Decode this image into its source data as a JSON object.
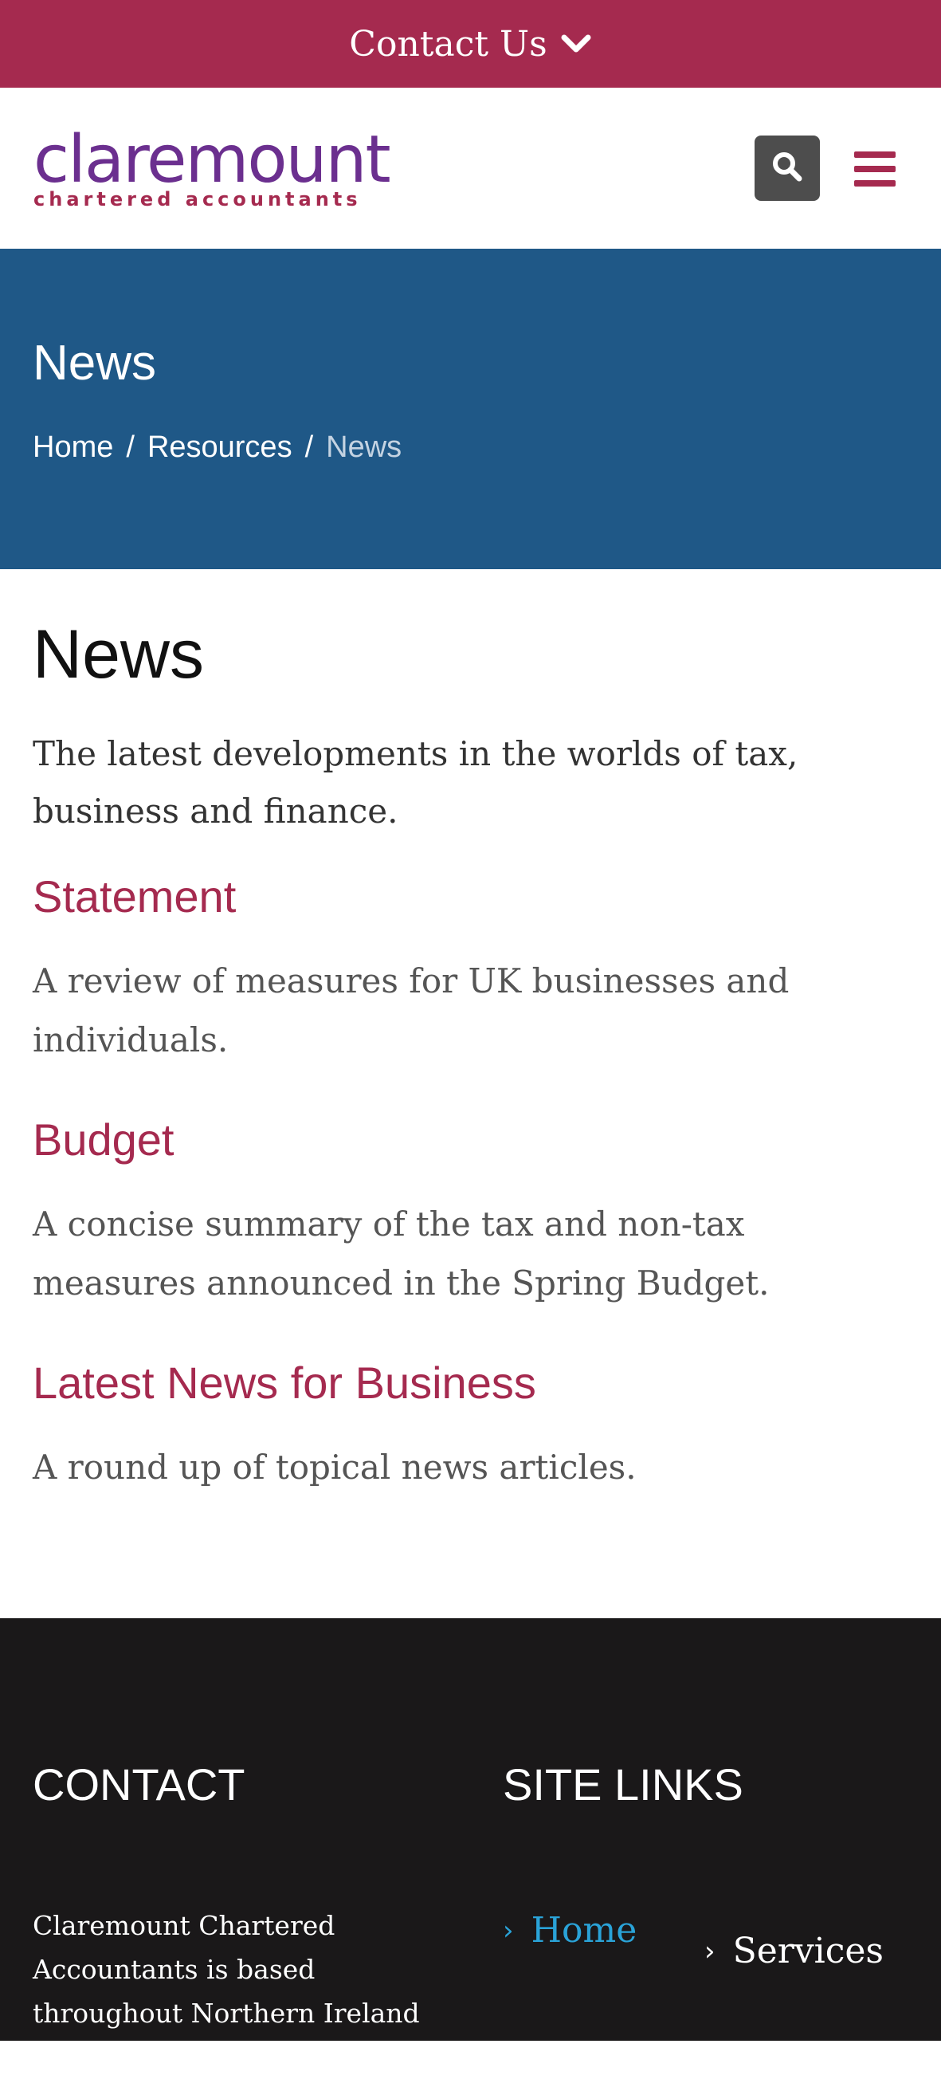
{
  "topbar": {
    "label": "Contact Us",
    "icon": "chevron-down-icon"
  },
  "header": {
    "logo_main": "claremount",
    "logo_sub": "chartered accountants",
    "search_icon": "search-icon",
    "menu_icon": "hamburger-icon"
  },
  "hero": {
    "title": "News",
    "breadcrumb": [
      "Home",
      "Resources",
      "News"
    ],
    "separator": "/"
  },
  "main": {
    "title": "News",
    "intro": "The latest developments in the worlds of tax, business and finance.",
    "sections": [
      {
        "title": "Statement",
        "text": "A review of measures for UK businesses and individuals."
      },
      {
        "title": "Budget",
        "text": "A concise summary of the tax and non-tax measures announced in the Spring Budget."
      },
      {
        "title": "Latest News for Business",
        "text": "A round up of topical news articles."
      }
    ]
  },
  "footer": {
    "contact_heading": "CONTACT",
    "links_heading": "SITE LINKS",
    "contact_text": "Claremount Chartered Accountants is based throughout Northern Ireland in",
    "links": [
      "Home",
      "Services"
    ]
  },
  "colors": {
    "brand_maroon": "#a52a4f",
    "brand_purple": "#6b2f8f",
    "hero_blue": "#1f5887",
    "footer_dark": "#1a1819",
    "link_blue": "#2aa3d8"
  }
}
